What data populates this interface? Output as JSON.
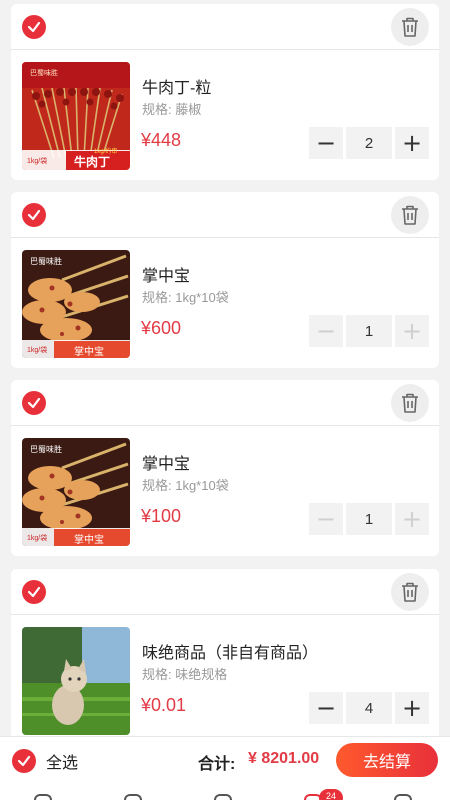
{
  "cart": {
    "items": [
      {
        "title": "牛肉丁-粒",
        "spec": "规格: 藤椒",
        "price": "¥448",
        "quantity": "2",
        "thumb_caption": "牛肉丁",
        "thumb_tag": "1kg/袋",
        "thumb_brand": "巴蜀味胜",
        "thumb_weight": "1kg/约串"
      },
      {
        "title": "掌中宝",
        "spec": "规格: 1kg*10袋",
        "price": "¥600",
        "quantity": "1",
        "thumb_caption": "掌中宝",
        "thumb_tag": "1kg/袋",
        "thumb_brand": "巴蜀味胜"
      },
      {
        "title": "掌中宝",
        "spec": "规格: 1kg*10袋",
        "price": "¥100",
        "quantity": "1",
        "thumb_caption": "掌中宝",
        "thumb_tag": "1kg/袋",
        "thumb_brand": "巴蜀味胜"
      },
      {
        "title": "味绝商品（非自有商品）",
        "spec": "规格: 味绝规格",
        "price": "¥0.01",
        "quantity": "4"
      }
    ],
    "stepper": {
      "minus": "−",
      "plus": "+"
    }
  },
  "bottom_bar": {
    "select_all_label": "全选",
    "total_label": "合计:",
    "total_value": "¥ 8201.00",
    "checkout_label": "去结算"
  },
  "tabbar": {
    "badge": "24"
  },
  "colors": {
    "accent": "#e8303a",
    "price": "#e23b46"
  }
}
